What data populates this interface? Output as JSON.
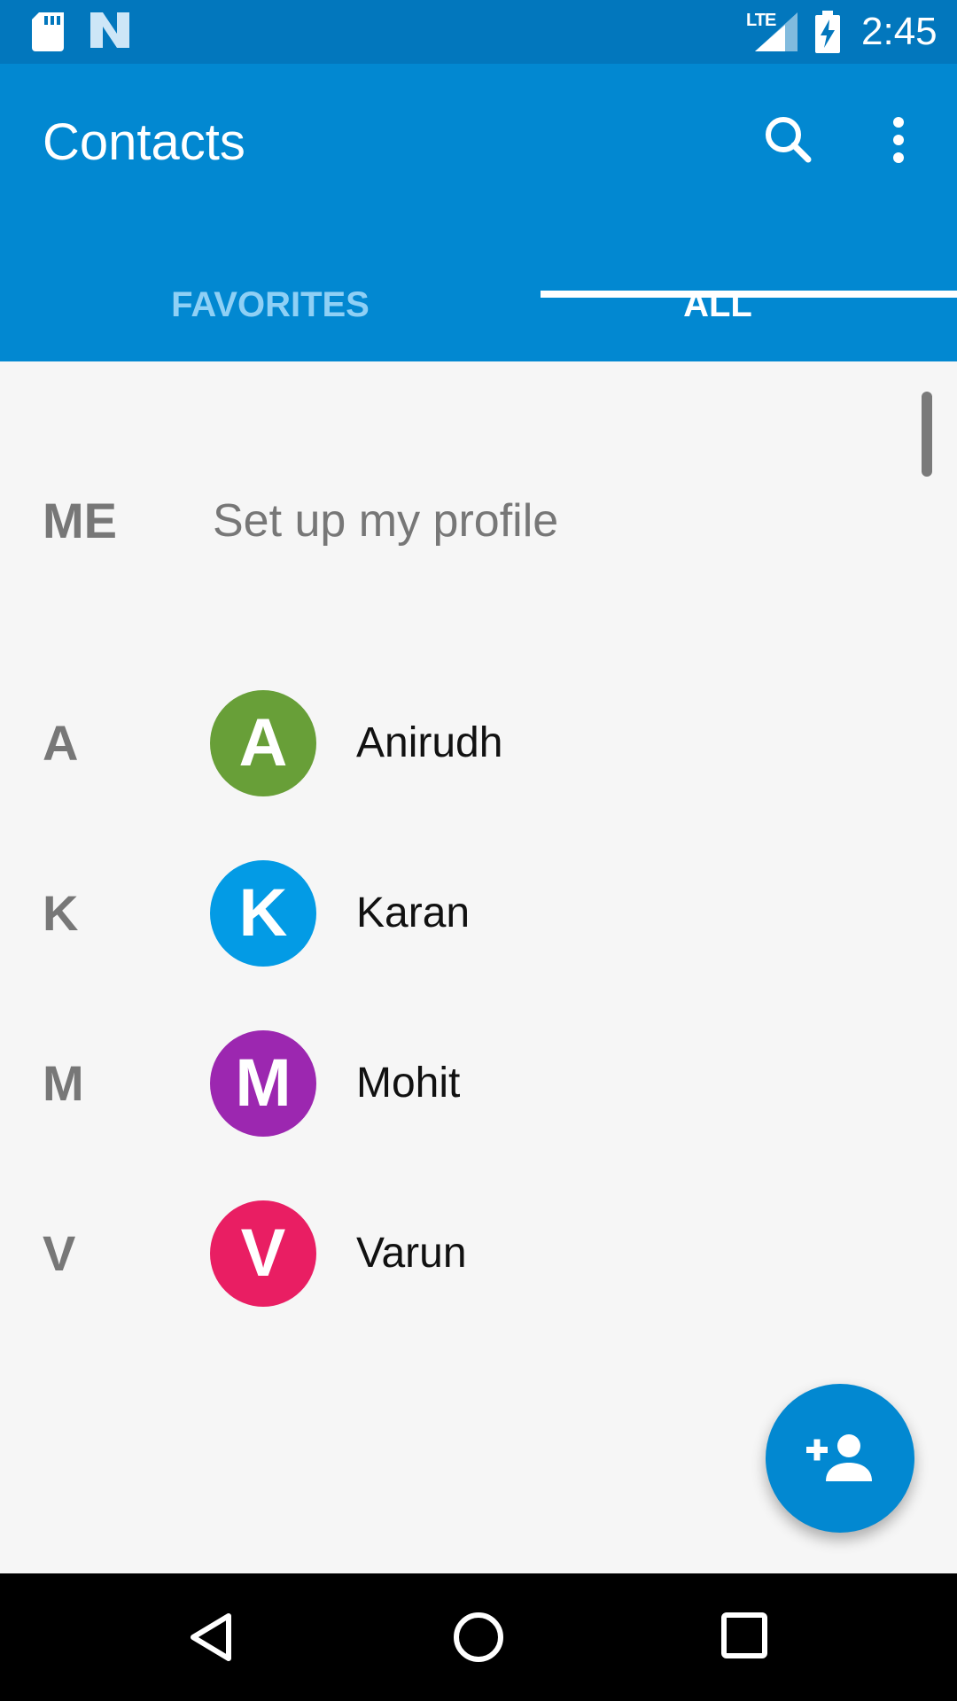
{
  "status_bar": {
    "time": "2:45",
    "network": "LTE",
    "icons": [
      "sd-card-icon",
      "n-logo-icon",
      "signal-icon",
      "battery-charging-icon"
    ]
  },
  "app_bar": {
    "title": "Contacts",
    "icons": [
      "search-icon",
      "more-vert-icon"
    ]
  },
  "tabs": [
    {
      "label": "FAVORITES",
      "selected": false
    },
    {
      "label": "ALL",
      "selected": true
    }
  ],
  "me": {
    "label": "ME",
    "text": "Set up my profile"
  },
  "contacts": [
    {
      "letter": "A",
      "avatar": "A",
      "name": "Anirudh",
      "color": "#689f38"
    },
    {
      "letter": "K",
      "avatar": "K",
      "name": "Karan",
      "color": "#039be5"
    },
    {
      "letter": "M",
      "avatar": "M",
      "name": "Mohit",
      "color": "#9c27b0"
    },
    {
      "letter": "V",
      "avatar": "V",
      "name": "Varun",
      "color": "#e91e63"
    }
  ],
  "fab": {
    "icon": "add-person-icon"
  },
  "nav_bar": {
    "icons": [
      "back-icon",
      "home-icon",
      "recents-icon"
    ]
  },
  "colors": {
    "primary": "#0288d1",
    "status_bar": "#0277bd"
  }
}
